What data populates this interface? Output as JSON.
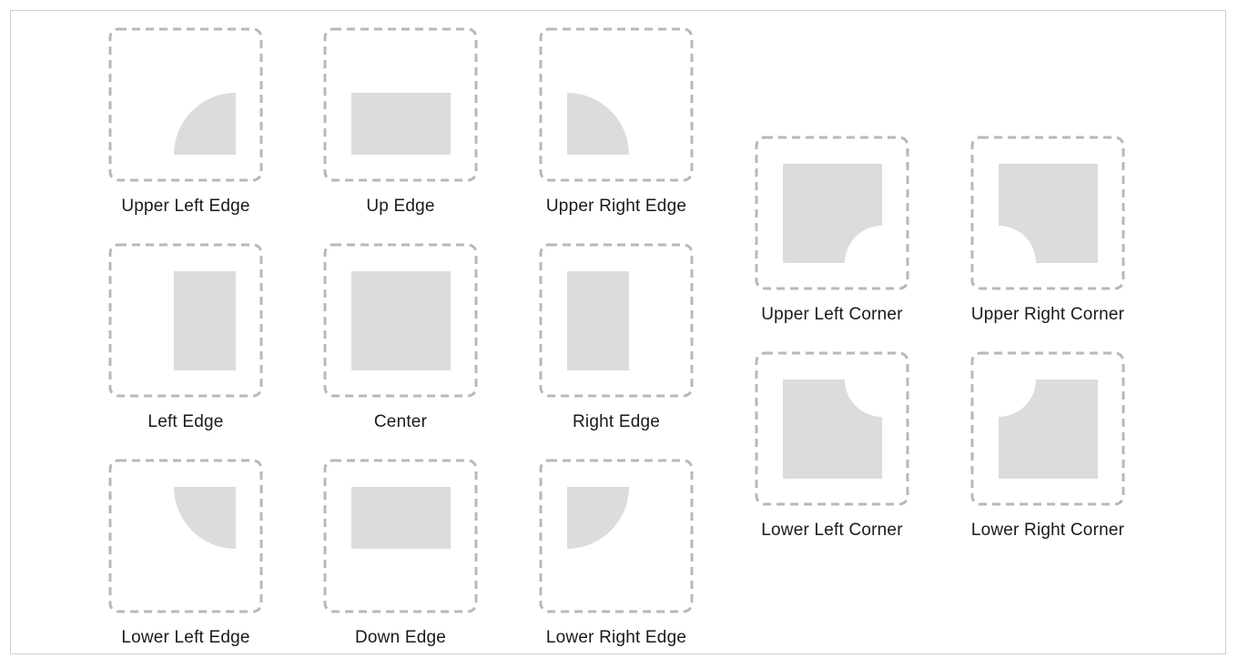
{
  "diagram": {
    "border_color": "#cfcfcf",
    "dash_color": "#b8b8b8",
    "fill_color": "#dcdcdc",
    "edges": [
      {
        "label": "Upper Left Edge",
        "shape": "upper-left-edge"
      },
      {
        "label": "Up Edge",
        "shape": "up-edge"
      },
      {
        "label": "Upper Right Edge",
        "shape": "upper-right-edge"
      },
      {
        "label": "Left Edge",
        "shape": "left-edge"
      },
      {
        "label": "Center",
        "shape": "center"
      },
      {
        "label": "Right Edge",
        "shape": "right-edge"
      },
      {
        "label": "Lower Left Edge",
        "shape": "lower-left-edge"
      },
      {
        "label": "Down Edge",
        "shape": "down-edge"
      },
      {
        "label": "Lower Right Edge",
        "shape": "lower-right-edge"
      }
    ],
    "corners": [
      {
        "label": "Upper Left Corner",
        "shape": "upper-left-corner"
      },
      {
        "label": "Upper Right Corner",
        "shape": "upper-right-corner"
      },
      {
        "label": "Lower Left Corner",
        "shape": "lower-left-corner"
      },
      {
        "label": "Lower Right Corner",
        "shape": "lower-right-corner"
      }
    ]
  }
}
